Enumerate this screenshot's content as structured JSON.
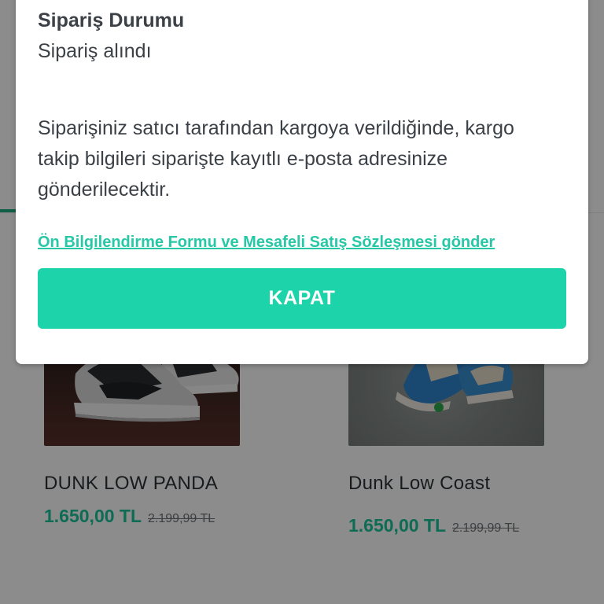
{
  "modal": {
    "title": "Sipariş Durumu",
    "status": "Sipariş alındı",
    "message": "Siparişiniz satıcı tarafından kargoya verildiğinde, kargo takip bilgileri siparişte kayıtlı e-posta adresinize gönderilecektir.",
    "link": "Ön Bilgilendirme Formu ve Mesafeli Satış Sözleşmesi gönder",
    "close_label": "KAPAT"
  },
  "products": [
    {
      "name": "DUNK LOW PANDA",
      "price": "1.650,00 TL",
      "old_price": "2.199,99 TL"
    },
    {
      "name": "Dunk Low Coast",
      "price": "1.650,00 TL",
      "old_price": "2.199,99 TL"
    }
  ],
  "colors": {
    "accent": "#1dd3aa",
    "price": "#1bc49a",
    "text": "#3b4147"
  }
}
